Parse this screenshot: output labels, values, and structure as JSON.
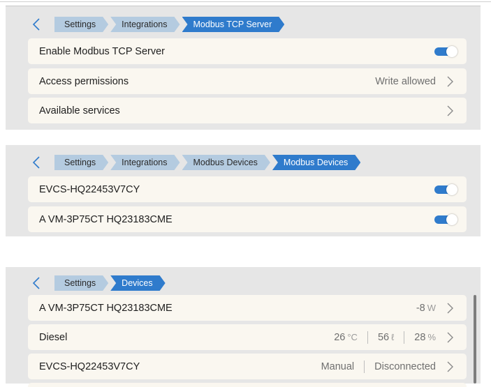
{
  "panel1": {
    "breadcrumbs": [
      "Settings",
      "Integrations",
      "Modbus TCP Server"
    ],
    "rows": [
      {
        "label": "Enable Modbus TCP Server",
        "toggle": true
      },
      {
        "label": "Access permissions",
        "value": "Write allowed"
      },
      {
        "label": "Available services"
      }
    ]
  },
  "panel2": {
    "breadcrumbs": [
      "Settings",
      "Integrations",
      "Modbus Devices",
      "Modbus Devices"
    ],
    "rows": [
      {
        "label": "EVCS-HQ22453V7CY",
        "toggle": true
      },
      {
        "label": "A VM-3P75CT HQ23183CME",
        "toggle": true
      }
    ]
  },
  "panel3": {
    "breadcrumbs": [
      "Settings",
      "Devices"
    ],
    "rows": [
      {
        "label": "A VM-3P75CT HQ23183CME",
        "power_value": "-8",
        "power_unit": "W"
      },
      {
        "label": "Diesel",
        "temp_value": "26",
        "temp_unit": "°C",
        "volume_value": "56",
        "volume_unit": "ℓ",
        "percent_value": "28",
        "percent_unit": "%"
      },
      {
        "label": "EVCS-HQ22453V7CY",
        "mode": "Manual",
        "status": "Disconnected"
      }
    ]
  },
  "icons": {
    "back": "chevron-left-icon",
    "forward": "chevron-right-icon"
  },
  "colors": {
    "accent": "#2f7bcc",
    "crumb_inactive": "#b4cbe0",
    "row_bg": "#faf7f0",
    "panel_bg": "#e6e6e6"
  }
}
